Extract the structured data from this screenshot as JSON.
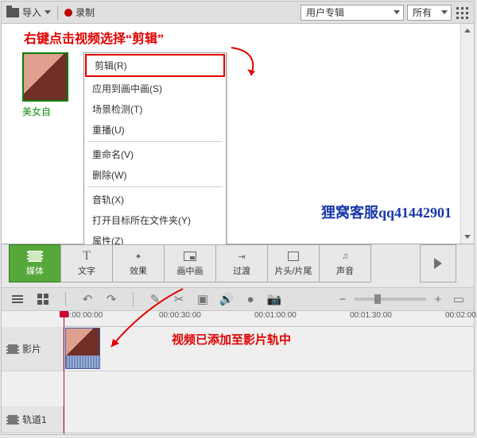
{
  "topbar": {
    "import_label": "导入",
    "record_label": "录制",
    "dropdown1_value": "用户专辑",
    "dropdown2_value": "所有"
  },
  "thumbnail": {
    "label": "美女自"
  },
  "context_menu": {
    "items": {
      "edit": "剪辑(R)",
      "pip": "应用到画中画(S)",
      "scene": "场景检测(T)",
      "replay": "重播(U)",
      "rename": "重命名(V)",
      "delete": "删除(W)",
      "audio": "音轨(X)",
      "open_folder": "打开目标所在文件夹(Y)",
      "props": "属性(Z)"
    }
  },
  "watermark": "狸窝客服qq41442901",
  "tabs": {
    "media": "媒体",
    "text": "文字",
    "effects": "效果",
    "pip": "画中画",
    "transition": "过渡",
    "intro": "片头/片尾",
    "sound": "声音"
  },
  "timeline": {
    "ticks": [
      "0:00:00:00",
      "00:00:30:00",
      "00:01:00:00",
      "00:01:30:00",
      "00:02:00:00"
    ],
    "track_video": "影片",
    "track_1": "轨道1"
  },
  "annotations": {
    "a1": "右键点击视频选择“剪辑”",
    "a2": "视频已添加至影片轨中"
  }
}
